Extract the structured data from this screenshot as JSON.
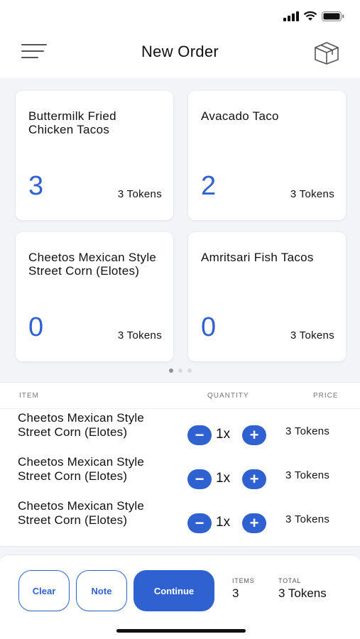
{
  "header": {
    "title": "New Order",
    "menu_icon": "hamburger-menu-icon",
    "box_icon": "box-icon"
  },
  "status_bar": {
    "icons": [
      "cellular-signal-icon",
      "wifi-icon",
      "battery-icon"
    ]
  },
  "menu_cards": [
    {
      "name": "Buttermilk Fried Chicken Tacos",
      "count": "3",
      "tokens": "3 Tokens"
    },
    {
      "name": "Avacado Taco",
      "count": "2",
      "tokens": "3 Tokens"
    },
    {
      "name": "Cheetos Mexican Style Street Corn (Elotes)",
      "count": "0",
      "tokens": "3 Tokens"
    },
    {
      "name": "Amritsari Fish Tacos",
      "count": "0",
      "tokens": "3 Tokens"
    }
  ],
  "pager": {
    "pages": 3,
    "active": 1
  },
  "order": {
    "columns": {
      "item": "ITEM",
      "quantity": "QUANTITY",
      "price": "PRICE"
    },
    "items": [
      {
        "name": "Cheetos Mexican Style Street Corn (Elotes)",
        "quantity": "1x",
        "price": "3 Tokens"
      },
      {
        "name": "Cheetos Mexican Style Street Corn (Elotes)",
        "quantity": "1x",
        "price": "3 Tokens"
      },
      {
        "name": "Cheetos Mexican Style Street Corn (Elotes)",
        "quantity": "1x",
        "price": "3 Tokens"
      }
    ],
    "minus_symbol": "−",
    "plus_symbol": "+"
  },
  "footer": {
    "clear_label": "Clear",
    "note_label": "Note",
    "continue_label": "Continue",
    "items_label": "ITEMS",
    "items_value": "3",
    "total_label": "TOTAL",
    "total_value": "3 Tokens"
  },
  "colors": {
    "accent": "#2f62d0",
    "background": "#f3f4f7"
  }
}
